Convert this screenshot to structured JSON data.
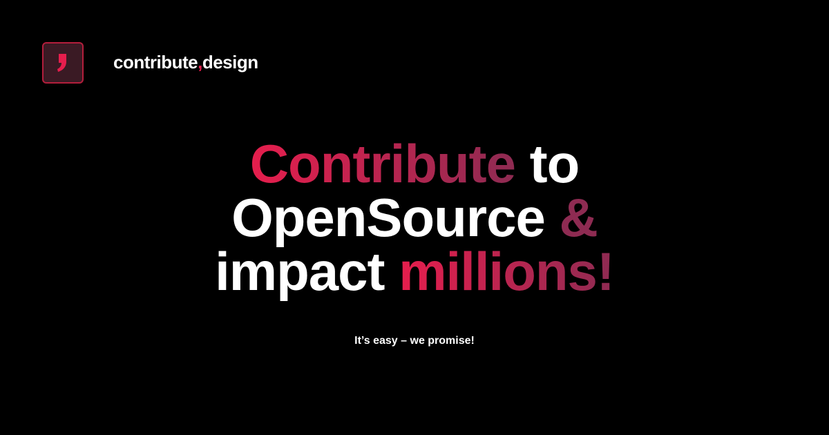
{
  "brand": {
    "name_start": "contribute",
    "name_comma": ",",
    "name_end": "design",
    "logo_icon": "comma-logo-icon",
    "accent_color": "#e61e4d",
    "secondary_accent_color": "#8e2b52"
  },
  "headline": {
    "line1_highlight": "Contribute",
    "line1_rest": " to",
    "line2_text": "OpenSource ",
    "line2_amp": "&",
    "line3_text": "impact ",
    "line3_highlight": "millions!"
  },
  "tagline": "It’s easy – we promise!"
}
